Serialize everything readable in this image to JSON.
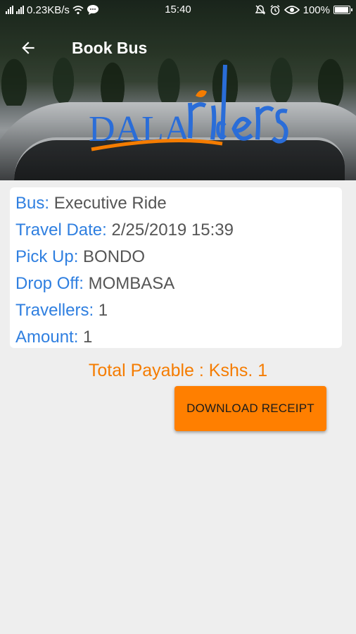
{
  "status_bar": {
    "network_speed": "0.23KB/s",
    "time": "15:40",
    "battery": "100%",
    "icons": [
      "signal-icon",
      "signal-icon",
      "wifi-icon",
      "chat-icon",
      "mute-icon",
      "alarm-icon",
      "eye-icon",
      "battery-icon"
    ]
  },
  "toolbar": {
    "back_icon": "arrow-left-icon",
    "title": "Book Bus"
  },
  "header_image": {
    "logo_text_left": "DALA",
    "logo_text_right": "riders",
    "colors": {
      "logo_blue": "#2a6dd8",
      "logo_orange": "#f57c00"
    }
  },
  "booking": {
    "bus_label": "Bus:",
    "bus_value": "Executive Ride",
    "travel_date_label": "Travel Date:",
    "travel_date_value": "2/25/2019 15:39",
    "pickup_label": "Pick Up:",
    "pickup_value": "BONDO",
    "dropoff_label": "Drop Off:",
    "dropoff_value": "MOMBASA",
    "travellers_label": "Travellers:",
    "travellers_value": "1",
    "amount_label": "Amount:",
    "amount_value": "1"
  },
  "total_payable": "Total Payable : Kshs. 1",
  "download_button": "DOWNLOAD RECEIPT",
  "colors": {
    "label_blue": "#2f7fe0",
    "accent_orange": "#ff7f00",
    "background": "#eeeeee"
  }
}
